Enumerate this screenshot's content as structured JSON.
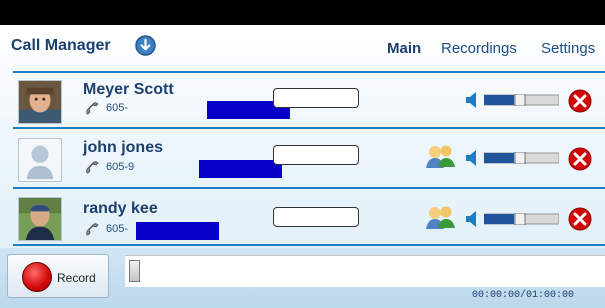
{
  "header": {
    "title": "Call Manager",
    "title_icon": "down-arrow-circle-icon",
    "nav": [
      {
        "label": "Main",
        "active": true
      },
      {
        "label": "Recordings",
        "active": false
      },
      {
        "label": "Settings",
        "active": false
      }
    ]
  },
  "contacts": [
    {
      "name": "Meyer Scott",
      "phone": "605-",
      "avatar": "photo-avatar",
      "show_conference_icon": false
    },
    {
      "name": "john jones",
      "phone": "605-9",
      "avatar": "silhouette-avatar",
      "show_conference_icon": true
    },
    {
      "name": "randy kee",
      "phone": "605-",
      "avatar": "photo-avatar",
      "show_conference_icon": true
    }
  ],
  "footer": {
    "record_label": "Record",
    "time": "00:00:00/01:00:00"
  },
  "colors": {
    "accent": "#1f7ec0",
    "heading": "#1d3f6f",
    "mask": "#0600c8",
    "remove": "#d10909"
  },
  "icons": {
    "speaker": "speaker-icon",
    "remove": "remove-icon",
    "phone": "phone-icon",
    "conference": "conference-icon",
    "record": "record-icon"
  }
}
